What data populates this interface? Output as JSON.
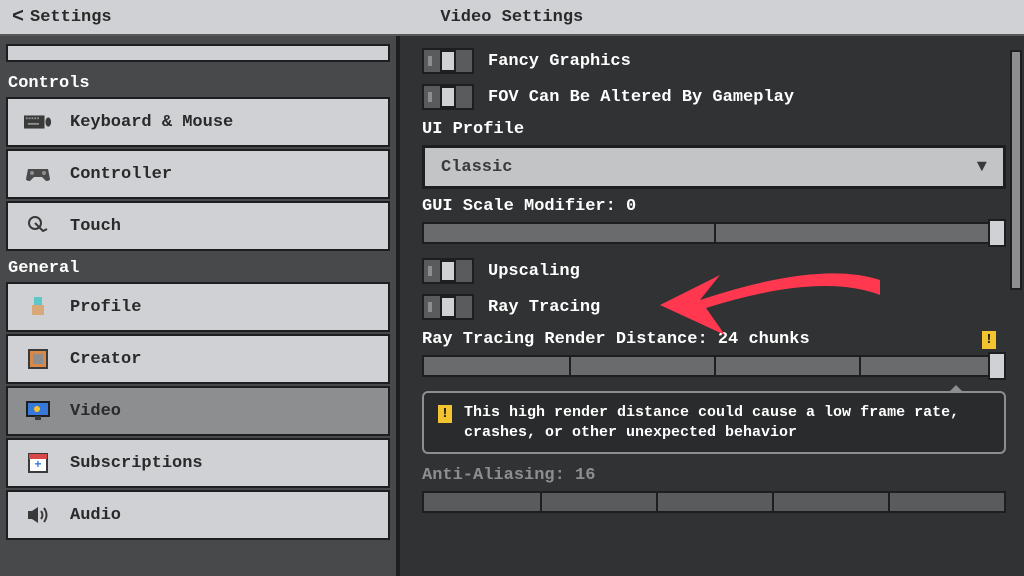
{
  "header": {
    "back": "Settings",
    "title": "Video Settings"
  },
  "sidebar": {
    "section1": "Controls",
    "section2": "General",
    "items1": [
      {
        "label": "Keyboard & Mouse"
      },
      {
        "label": "Controller"
      },
      {
        "label": "Touch"
      }
    ],
    "items2": [
      {
        "label": "Profile"
      },
      {
        "label": "Creator"
      },
      {
        "label": "Video"
      },
      {
        "label": "Subscriptions"
      },
      {
        "label": "Audio"
      }
    ]
  },
  "content": {
    "toggle_fancy": "Fancy Graphics",
    "toggle_fov": "FOV Can Be Altered By Gameplay",
    "ui_profile_label": "UI Profile",
    "ui_profile_value": "Classic",
    "gui_scale_label": "GUI Scale Modifier: 0",
    "toggle_upscaling": "Upscaling",
    "toggle_raytracing": "Ray Tracing",
    "rt_render_label": "Ray Tracing Render Distance: 24 chunks",
    "warning": "This high render distance could cause a low frame rate, crashes, or other unexpected behavior",
    "aa_label": "Anti-Aliasing: 16"
  }
}
